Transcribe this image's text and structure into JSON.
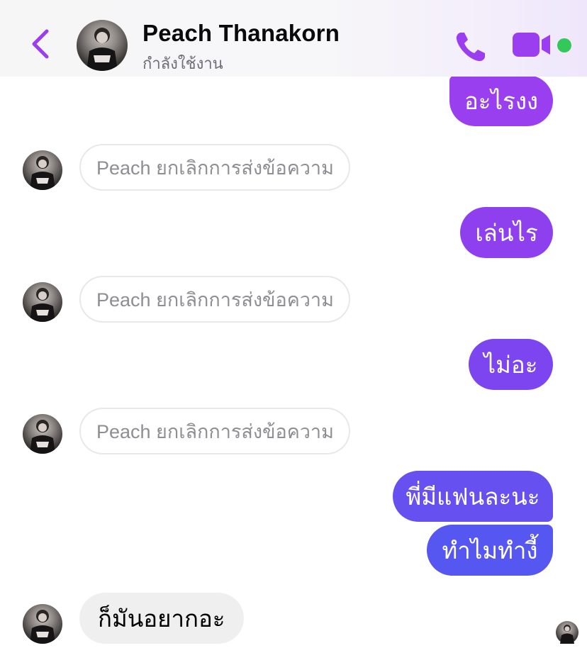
{
  "header": {
    "contact_name": "Peach Thanakorn",
    "status": "กำลังใช้งาน",
    "icons": [
      "chevron-left-icon",
      "phone-icon",
      "video-camera-icon"
    ],
    "online": true
  },
  "messages": [
    {
      "direction": "outgoing",
      "text": "อะไรงง"
    },
    {
      "direction": "incoming",
      "unsent": true,
      "text": "Peach ยกเลิกการส่งข้อความ"
    },
    {
      "direction": "outgoing",
      "text": "เล่นไร"
    },
    {
      "direction": "incoming",
      "unsent": true,
      "text": "Peach ยกเลิกการส่งข้อความ"
    },
    {
      "direction": "outgoing",
      "text": "ไม่อะ"
    },
    {
      "direction": "incoming",
      "unsent": true,
      "text": "Peach ยกเลิกการส่งข้อความ"
    },
    {
      "direction": "outgoing",
      "text": "พี่มีแฟนละนะ"
    },
    {
      "direction": "outgoing",
      "text": "ทำไมทำงี้"
    },
    {
      "direction": "incoming",
      "text": "ก็มันอยากอะ"
    }
  ],
  "colors": {
    "accent_purple": "#9b3ef0",
    "outgoing_gradient_top": "#8c3fec",
    "outgoing_gradient_bottom": "#4f5cf0",
    "incoming_bubble": "#efefef",
    "online_green": "#34c759"
  }
}
